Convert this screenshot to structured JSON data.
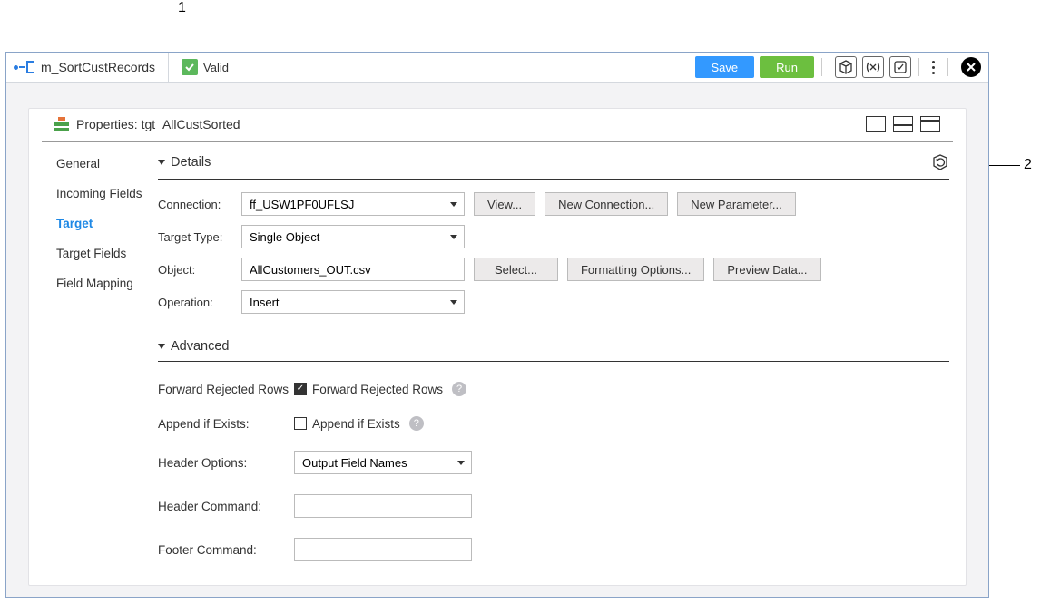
{
  "callouts": {
    "one": "1",
    "two": "2"
  },
  "toolbar": {
    "title": "m_SortCustRecords",
    "valid_label": "Valid",
    "save_label": "Save",
    "run_label": "Run"
  },
  "properties": {
    "header_prefix": "Properties: ",
    "header_object": "tgt_AllCustSorted"
  },
  "side_tabs": {
    "general": "General",
    "incoming": "Incoming Fields",
    "target": "Target",
    "target_fields": "Target Fields",
    "field_mapping": "Field Mapping"
  },
  "details": {
    "section_title": "Details",
    "connection_label": "Connection:",
    "connection_value": "ff_USW1PF0UFLSJ",
    "view_btn": "View...",
    "new_conn_btn": "New Connection...",
    "new_param_btn": "New Parameter...",
    "target_type_label": "Target Type:",
    "target_type_value": "Single Object",
    "object_label": "Object:",
    "object_value": "AllCustomers_OUT.csv",
    "select_btn": "Select...",
    "fmt_btn": "Formatting Options...",
    "preview_btn": "Preview Data...",
    "operation_label": "Operation:",
    "operation_value": "Insert"
  },
  "advanced": {
    "section_title": "Advanced",
    "frr_label": "Forward Rejected Rows",
    "frr_cb_label": "Forward Rejected Rows",
    "append_label": "Append if Exists:",
    "append_cb_label": "Append if Exists",
    "header_opts_label": "Header Options:",
    "header_opts_value": "Output Field Names",
    "header_cmd_label": "Header Command:",
    "header_cmd_value": "",
    "footer_cmd_label": "Footer Command:",
    "footer_cmd_value": ""
  }
}
